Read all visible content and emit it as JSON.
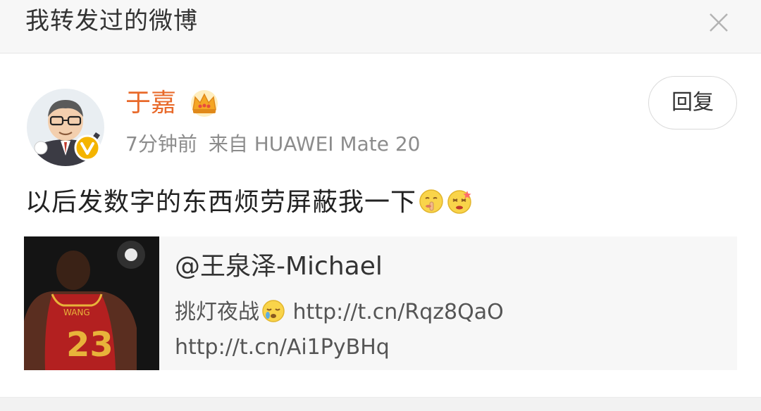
{
  "header": {
    "title": "我转发过的微博",
    "close_icon": "close-icon"
  },
  "post": {
    "author": "于嘉",
    "badge_icon": "crown-icon",
    "verified_icon": "verified-v-icon",
    "time": "7分钟前",
    "source": "来自 HUAWEI Mate 20",
    "reply_label": "回复",
    "text": "以后发数字的东西烦劳屏蔽我一下",
    "emojis": [
      "shush-face-icon",
      "dizzy-face-icon"
    ]
  },
  "repost": {
    "author": "@王泉泽-Michael",
    "line1_text": "挑灯夜战",
    "line1_emoji": "sleepy-face-icon",
    "line1_link": "http://t.cn/Rqz8QaO",
    "line2_link": "http://t.cn/Ai1PyBHq",
    "image_icon": "basketball-player-photo"
  },
  "colors": {
    "accent": "#e86a2b",
    "meta": "#8c8c8c",
    "header_bg": "#f7f7f7",
    "repost_bg": "#f7f7f7"
  }
}
